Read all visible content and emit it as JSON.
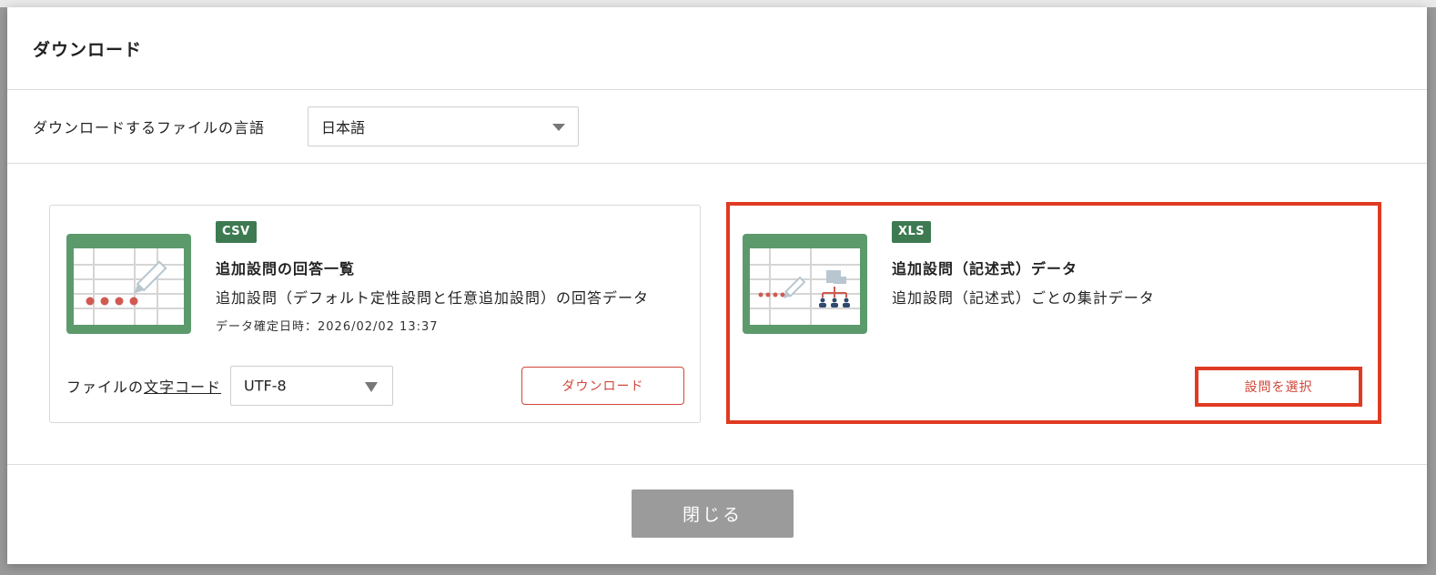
{
  "modal": {
    "title": "ダウンロード",
    "language_label": "ダウンロードするファイルの言語",
    "language_value": "日本語",
    "close_label": "閉じる"
  },
  "cards": [
    {
      "badge": "CSV",
      "title": "追加設問の回答一覧",
      "description": "追加設問（デフォルト定性設問と任意追加設問）の回答データ",
      "meta": "データ確定日時：2026/02/02 13:37",
      "encoding_label_prefix": "ファイルの",
      "encoding_label_link": "文字コード",
      "encoding_value": "UTF-8",
      "button_label": "ダウンロード"
    },
    {
      "badge": "XLS",
      "title": "追加設問（記述式）データ",
      "description": "追加設問（記述式）ごとの集計データ",
      "button_label": "設問を選択"
    }
  ],
  "colors": {
    "accent_red": "#e03a22",
    "button_text_red": "#d0473a",
    "badge_green": "#3d7a52",
    "icon_green": "#5c9a6c",
    "close_gray": "#9b9b9b"
  }
}
